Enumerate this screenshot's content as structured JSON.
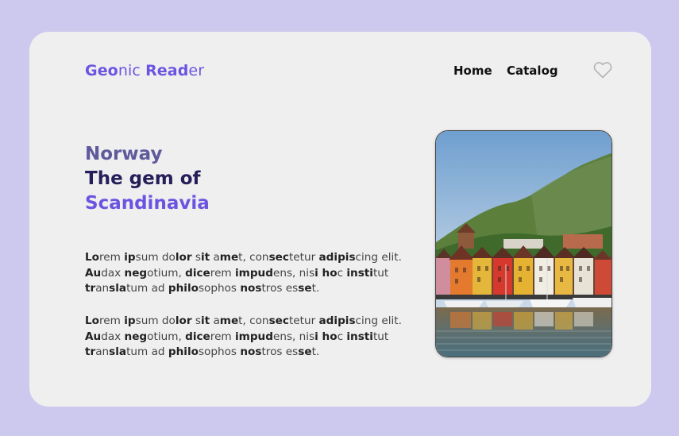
{
  "app": {
    "logo_parts": [
      {
        "t": "Geo",
        "b": true
      },
      {
        "t": "nic",
        "b": false
      },
      {
        "t": " ",
        "b": false
      },
      {
        "t": "Rea",
        "b": true
      },
      {
        "t": "d",
        "b": true
      },
      {
        "t": "er",
        "b": false
      }
    ]
  },
  "nav": {
    "home": "Home",
    "catalog": "Catalog"
  },
  "icons": {
    "favorite": "heart-icon"
  },
  "hero": {
    "line1": "Norway",
    "line2": "The gem of",
    "line3": "Scandinavia"
  },
  "paragraphs": [
    [
      [
        {
          "t": "Lo",
          "b": true
        },
        {
          "t": "rem ",
          "b": false
        },
        {
          "t": "ip",
          "b": true
        },
        {
          "t": "sum do",
          "b": false
        },
        {
          "t": "lor",
          "b": true
        },
        {
          "t": " s",
          "b": false
        },
        {
          "t": "it",
          "b": true
        },
        {
          "t": " a",
          "b": false
        },
        {
          "t": "me",
          "b": true
        },
        {
          "t": "t, con",
          "b": false
        },
        {
          "t": "sec",
          "b": true
        },
        {
          "t": "tetur ",
          "b": false
        },
        {
          "t": "adipis",
          "b": true
        },
        {
          "t": "cing elit.",
          "b": false
        }
      ],
      [
        {
          "t": "Au",
          "b": true
        },
        {
          "t": "dax ",
          "b": false
        },
        {
          "t": "neg",
          "b": true
        },
        {
          "t": "otium, ",
          "b": false
        },
        {
          "t": "dice",
          "b": true
        },
        {
          "t": "rem ",
          "b": false
        },
        {
          "t": "impud",
          "b": true
        },
        {
          "t": "ens, nis",
          "b": false
        },
        {
          "t": "i ho",
          "b": true
        },
        {
          "t": "c ",
          "b": false
        },
        {
          "t": "insti",
          "b": true
        },
        {
          "t": "tut",
          "b": false
        }
      ],
      [
        {
          "t": "tr",
          "b": true
        },
        {
          "t": "an",
          "b": false
        },
        {
          "t": "sla",
          "b": true
        },
        {
          "t": "tum ad ",
          "b": false
        },
        {
          "t": "philo",
          "b": true
        },
        {
          "t": "sophos ",
          "b": false
        },
        {
          "t": "nos",
          "b": true
        },
        {
          "t": "tros es",
          "b": false
        },
        {
          "t": "se",
          "b": true
        },
        {
          "t": "t.",
          "b": false
        }
      ]
    ],
    [
      [
        {
          "t": "Lo",
          "b": true
        },
        {
          "t": "rem ",
          "b": false
        },
        {
          "t": "ip",
          "b": true
        },
        {
          "t": "sum do",
          "b": false
        },
        {
          "t": "lor",
          "b": true
        },
        {
          "t": " s",
          "b": false
        },
        {
          "t": "it",
          "b": true
        },
        {
          "t": " a",
          "b": false
        },
        {
          "t": "me",
          "b": true
        },
        {
          "t": "t, con",
          "b": false
        },
        {
          "t": "sec",
          "b": true
        },
        {
          "t": "tetur ",
          "b": false
        },
        {
          "t": "adipis",
          "b": true
        },
        {
          "t": "cing elit.",
          "b": false
        }
      ],
      [
        {
          "t": "Au",
          "b": true
        },
        {
          "t": "dax ",
          "b": false
        },
        {
          "t": "neg",
          "b": true
        },
        {
          "t": "otium, ",
          "b": false
        },
        {
          "t": "dice",
          "b": true
        },
        {
          "t": "rem ",
          "b": false
        },
        {
          "t": "impud",
          "b": true
        },
        {
          "t": "ens, nis",
          "b": false
        },
        {
          "t": "i ho",
          "b": true
        },
        {
          "t": "c ",
          "b": false
        },
        {
          "t": "insti",
          "b": true
        },
        {
          "t": "tut",
          "b": false
        }
      ],
      [
        {
          "t": "tr",
          "b": true
        },
        {
          "t": "an",
          "b": false
        },
        {
          "t": "sla",
          "b": true
        },
        {
          "t": "tum ad ",
          "b": false
        },
        {
          "t": "philo",
          "b": true
        },
        {
          "t": "sophos ",
          "b": false
        },
        {
          "t": "nos",
          "b": true
        },
        {
          "t": "tros es",
          "b": false
        },
        {
          "t": "se",
          "b": true
        },
        {
          "t": "t.",
          "b": false
        }
      ]
    ]
  ],
  "colors": {
    "accent": "#6b55e0",
    "dark": "#241f59",
    "muted": "#5f5a9c",
    "background": "#cdc9ee"
  }
}
